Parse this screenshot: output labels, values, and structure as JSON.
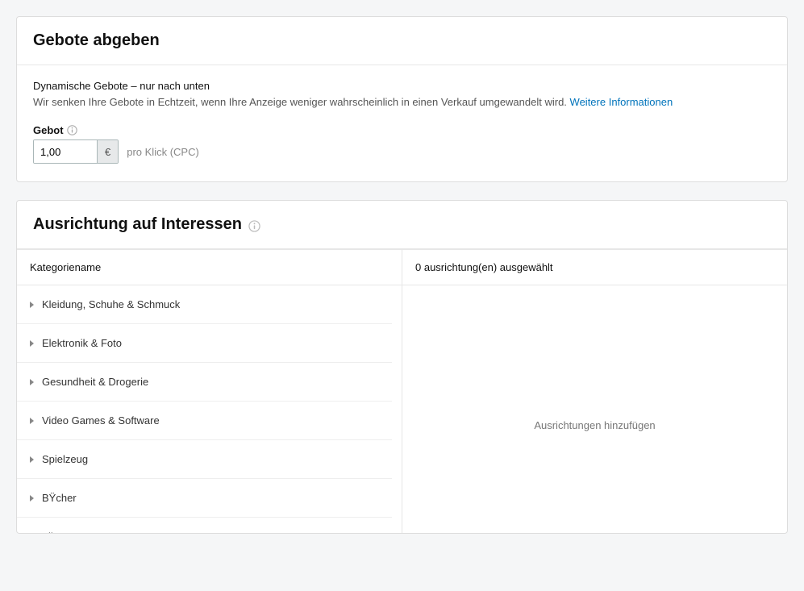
{
  "bids_panel": {
    "title": "Gebote abgeben",
    "strategy_title": "Dynamische Gebote – nur nach unten",
    "strategy_desc": "Wir senken Ihre Gebote in Echtzeit, wenn Ihre Anzeige weniger wahrscheinlich in einen Verkauf umgewandelt wird.",
    "learn_more": "Weitere Informationen",
    "bid_label": "Gebot",
    "bid_value": "1,00",
    "currency": "€",
    "cpc_hint": "pro Klick (CPC)"
  },
  "targeting_panel": {
    "title": "Ausrichtung auf Interessen",
    "left_header": "Kategoriename",
    "right_header": "0 ausrichtung(en) ausgewählt",
    "empty_text": "Ausrichtungen hinzufügen",
    "categories": [
      {
        "label": "Kleidung, Schuhe & Schmuck"
      },
      {
        "label": "Elektronik & Foto"
      },
      {
        "label": "Gesundheit & Drogerie"
      },
      {
        "label": "Video Games & Software"
      },
      {
        "label": "Spielzeug"
      },
      {
        "label": "BŸcher"
      },
      {
        "label": "Filme & TV"
      }
    ]
  }
}
